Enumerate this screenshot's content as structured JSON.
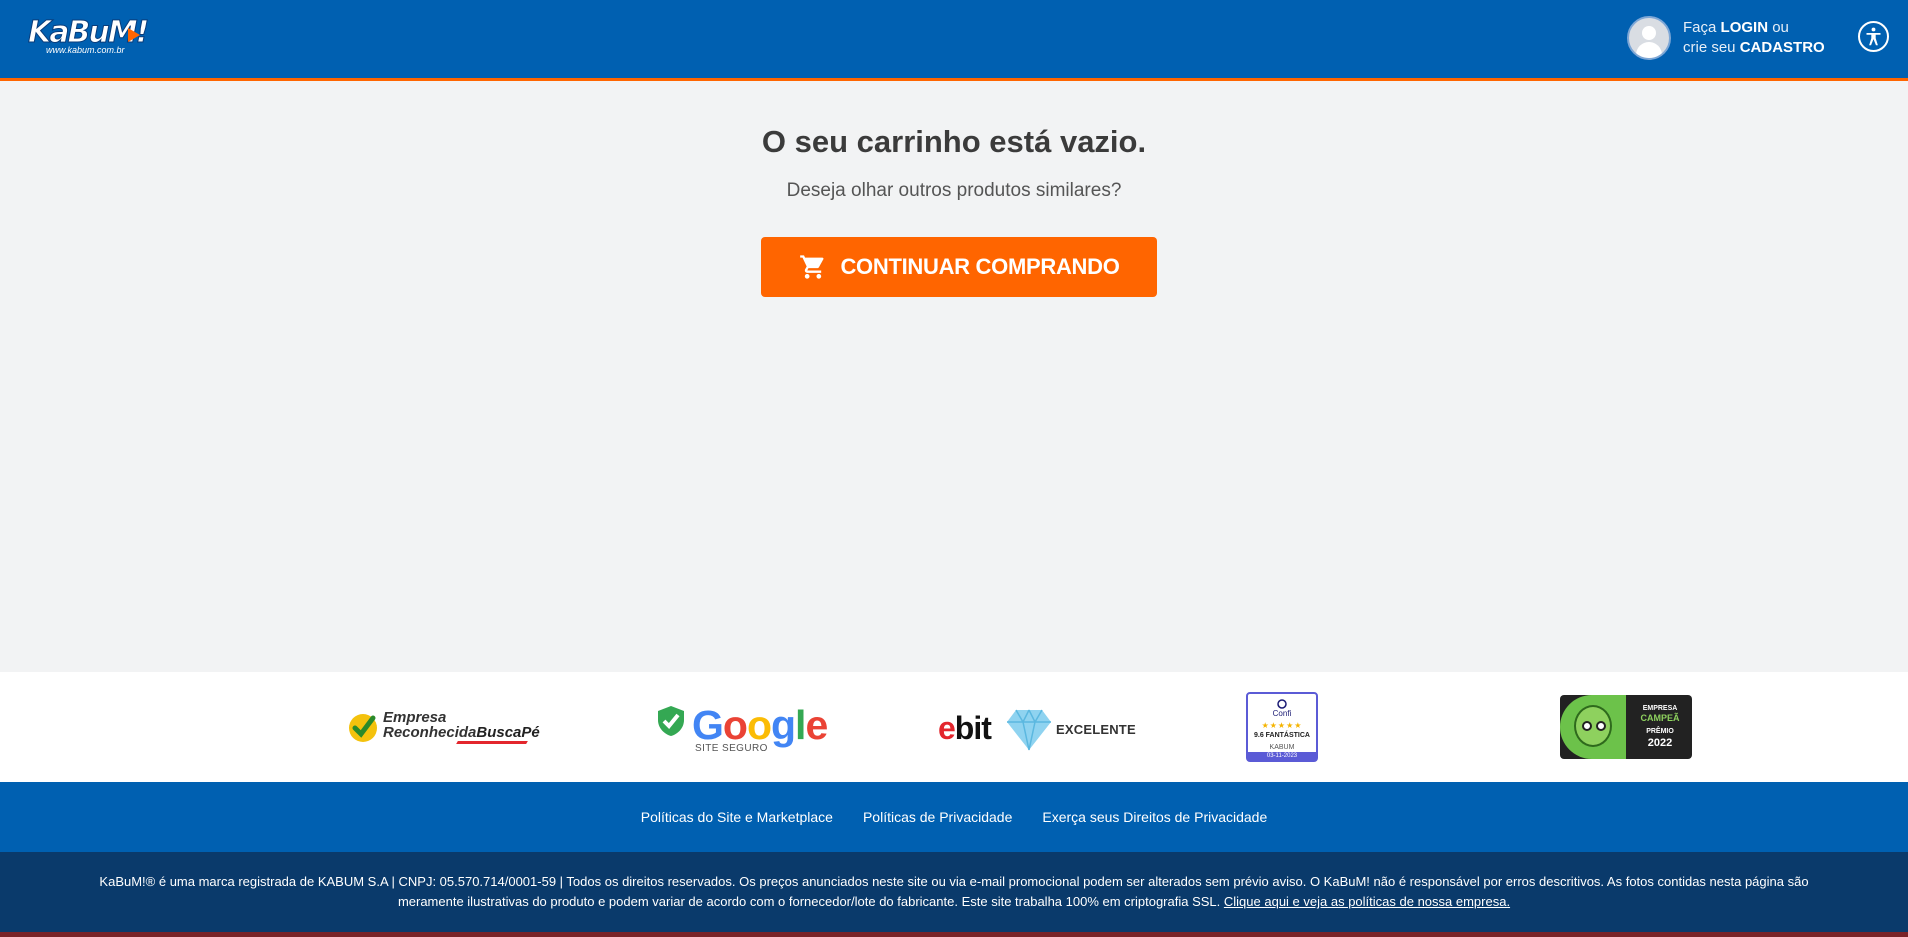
{
  "header": {
    "logo_text": "KaBuM!",
    "logo_url": "www.kabum.com.br",
    "login_line1_prefix": "Faça",
    "login_line1_bold": "LOGIN",
    "login_line1_suffix": "ou",
    "login_line2_prefix": "crie seu",
    "login_line2_bold": "CADASTRO"
  },
  "main": {
    "title": "O seu carrinho está vazio.",
    "subtitle": "Deseja olhar outros produtos similares?",
    "cta_label": "CONTINUAR COMPRANDO"
  },
  "seals": {
    "buscape_line1": "Empresa",
    "buscape_line2": "Reconhecida",
    "buscape_brand": "BuscaPé",
    "google_subtitle": "SITE SEGURO",
    "ebit_label": "EXCELENTE",
    "confi_brand": "Confi",
    "confi_score": "9.6 FANTÁSTICA",
    "confi_name": "KABUM",
    "confi_date": "03-11-2023",
    "premio_l1": "EMPRESA",
    "premio_l2": "CAMPEÃ",
    "premio_l3": "PRÊMIO",
    "premio_l4": "2022"
  },
  "footer": {
    "links": [
      "Políticas do Site e Marketplace",
      "Políticas de Privacidade",
      "Exerça seus Direitos de Privacidade"
    ],
    "legal_text": "KaBuM!® é uma marca registrada de KABUM S.A | CNPJ: 05.570.714/0001-59 | Todos os direitos reservados. Os preços anunciados neste site ou via e-mail promocional podem ser alterados sem prévio aviso. O KaBuM! não é responsável por erros descritivos. As fotos contidas nesta página são meramente ilustrativas do produto e podem variar de acordo com o fornecedor/lote do fabricante. Este site trabalha 100% em criptografia SSL. ",
    "legal_link": "Clique aqui e veja as políticas de nossa empresa."
  },
  "colors": {
    "primary_blue": "#0060b1",
    "accent_orange": "#ff6500",
    "dark_blue": "#0a3a6b"
  }
}
